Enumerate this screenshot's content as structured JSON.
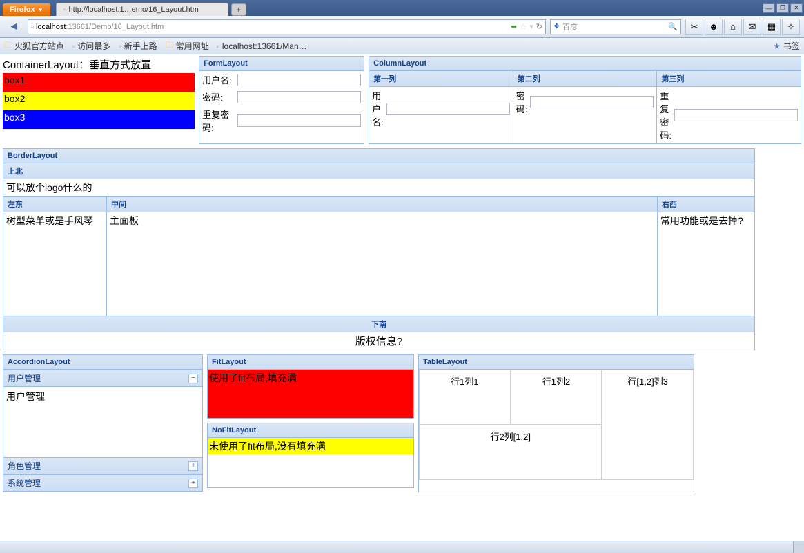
{
  "browser": {
    "name": "Firefox",
    "tab_title": "http://localhost:1…emo/16_Layout.htm",
    "url_host": "localhost",
    "url_rest": ":13661/Demo/16_Layout.htm",
    "search_placeholder": "百度"
  },
  "bookmarks": {
    "items": [
      "火狐官方站点",
      "访问最多",
      "新手上路",
      "常用网址",
      "localhost:13661/Man…"
    ],
    "label_right": "书签"
  },
  "container": {
    "title": "ContainerLayout：垂直方式放置",
    "boxes": [
      "box1",
      "box2",
      "box3"
    ]
  },
  "form": {
    "title": "FormLayout",
    "fields": [
      "用户名:",
      "密码:",
      "重复密码:"
    ]
  },
  "column": {
    "title": "ColumnLayout",
    "cols": [
      {
        "h": "第一列",
        "label": "用户名:"
      },
      {
        "h": "第二列",
        "label": "密码:"
      },
      {
        "h": "第三列",
        "label": "重复密码:"
      }
    ]
  },
  "border": {
    "title": "BorderLayout",
    "north_h": "上北",
    "north_c": "可以放个logo什么的",
    "west_h": "左东",
    "west_c": "树型菜单或是手风琴",
    "center_h": "中间",
    "center_c": "主面板",
    "east_h": "右西",
    "east_c": "常用功能或是去掉?",
    "south_h": "下南",
    "south_c": "版权信息?"
  },
  "accordion": {
    "title": "AccordionLayout",
    "open_h": "用户管理",
    "open_c": "用户管理",
    "closed": [
      "角色管理",
      "系统管理"
    ]
  },
  "fit": {
    "title": "FitLayout",
    "body": "使用了fit布局,填充满"
  },
  "nofit": {
    "title": "NoFitLayout",
    "body": "未使用了fit布局,没有填充满"
  },
  "table": {
    "title": "TableLayout",
    "cells": [
      "行1列1",
      "行1列2",
      "行[1,2]列3",
      "行2列[1,2]"
    ]
  }
}
